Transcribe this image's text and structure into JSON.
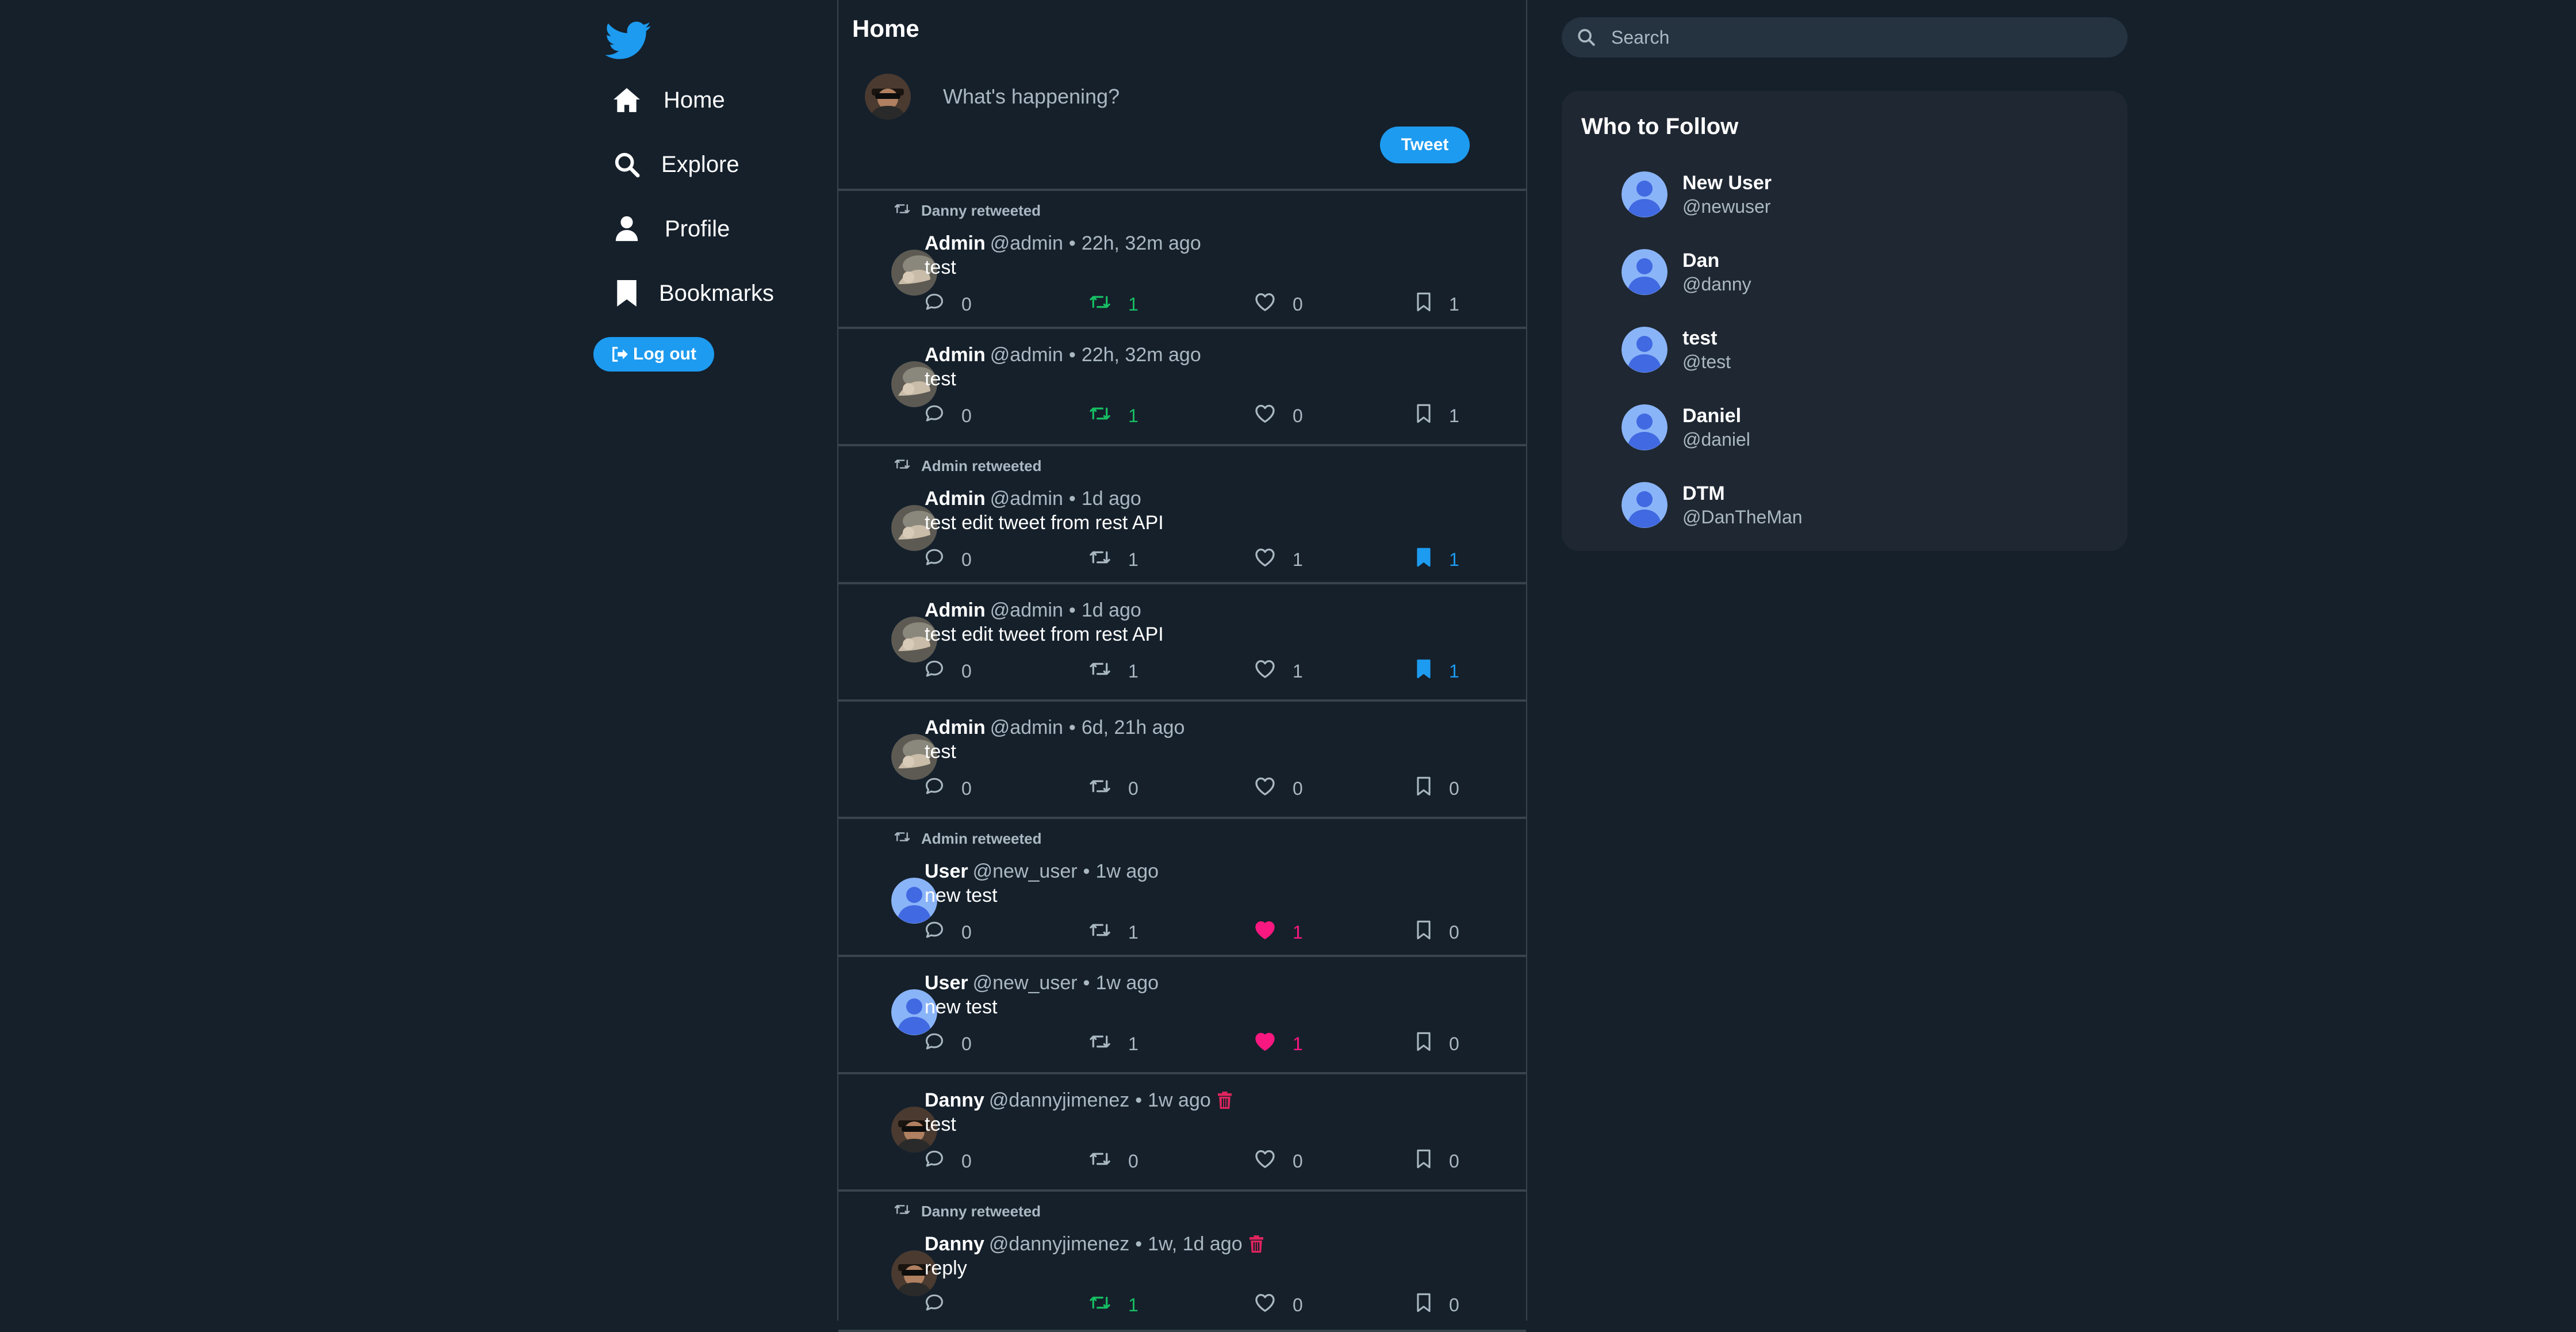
{
  "colors": {
    "background": "#15202b",
    "accent": "#1d9bf0",
    "retweet_active": "#17bf63",
    "like_active": "#f91880",
    "delete": "#e0245e",
    "muted": "#aab8c2",
    "border": "#38444d"
  },
  "nav": {
    "logo_icon": "twitter-bird-icon",
    "items": [
      {
        "label": "Home",
        "icon": "home-icon"
      },
      {
        "label": "Explore",
        "icon": "search-icon"
      },
      {
        "label": "Profile",
        "icon": "person-icon"
      },
      {
        "label": "Bookmarks",
        "icon": "bookmark-icon"
      }
    ],
    "logout_label": "Log out"
  },
  "feed": {
    "title": "Home",
    "composer": {
      "placeholder": "What's happening?",
      "button_label": "Tweet"
    },
    "tweets": [
      {
        "retweeted_by": "Danny retweeted",
        "name": "Admin",
        "handle": "@admin",
        "time": "22h, 32m ago",
        "text": "test",
        "replies": "0",
        "retweets": "1",
        "likes": "0",
        "bookmarks": "1",
        "retweeted": true,
        "liked": false,
        "bookmarked": false,
        "avatar": "photo-avatar"
      },
      {
        "retweeted_by": "",
        "name": "Admin",
        "handle": "@admin",
        "time": "22h, 32m ago",
        "text": "test",
        "replies": "0",
        "retweets": "1",
        "likes": "0",
        "bookmarks": "1",
        "retweeted": true,
        "liked": false,
        "bookmarked": false,
        "avatar": "photo-avatar"
      },
      {
        "retweeted_by": "Admin retweeted",
        "name": "Admin",
        "handle": "@admin",
        "time": "1d ago",
        "text": "test edit tweet from rest API",
        "replies": "0",
        "retweets": "1",
        "likes": "1",
        "bookmarks": "1",
        "retweeted": false,
        "liked": false,
        "bookmarked": true,
        "avatar": "photo-avatar"
      },
      {
        "retweeted_by": "",
        "name": "Admin",
        "handle": "@admin",
        "time": "1d ago",
        "text": "test edit tweet from rest API",
        "replies": "0",
        "retweets": "1",
        "likes": "1",
        "bookmarks": "1",
        "retweeted": false,
        "liked": false,
        "bookmarked": true,
        "avatar": "photo-avatar"
      },
      {
        "retweeted_by": "",
        "name": "Admin",
        "handle": "@admin",
        "time": "6d, 21h ago",
        "text": "test",
        "replies": "0",
        "retweets": "0",
        "likes": "0",
        "bookmarks": "0",
        "retweeted": false,
        "liked": false,
        "bookmarked": false,
        "avatar": "photo-avatar"
      },
      {
        "retweeted_by": "Admin retweeted",
        "name": "User",
        "handle": "@new_user",
        "time": "1w ago",
        "text": "new test",
        "replies": "0",
        "retweets": "1",
        "likes": "1",
        "bookmarks": "0",
        "retweeted": false,
        "liked": true,
        "bookmarked": false,
        "avatar": "default-avatar"
      },
      {
        "retweeted_by": "",
        "name": "User",
        "handle": "@new_user",
        "time": "1w ago",
        "text": "new test",
        "replies": "0",
        "retweets": "1",
        "likes": "1",
        "bookmarks": "0",
        "retweeted": false,
        "liked": true,
        "bookmarked": false,
        "avatar": "default-avatar"
      },
      {
        "retweeted_by": "",
        "name": "Danny",
        "handle": "@dannyjimenez",
        "time": "1w ago",
        "text": "test",
        "replies": "0",
        "retweets": "0",
        "likes": "0",
        "bookmarks": "0",
        "retweeted": false,
        "liked": false,
        "bookmarked": false,
        "deletable": true,
        "avatar": "photo-avatar-danny"
      },
      {
        "retweeted_by": "Danny retweeted",
        "name": "Danny",
        "handle": "@dannyjimenez",
        "time": "1w, 1d ago",
        "text": "reply",
        "replies": "",
        "retweets": "1",
        "likes": "0",
        "bookmarks": "0",
        "retweeted": true,
        "liked": false,
        "bookmarked": false,
        "deletable": true,
        "avatar": "photo-avatar-danny"
      }
    ]
  },
  "search": {
    "placeholder": "Search"
  },
  "who_to_follow": {
    "title": "Who to Follow",
    "users": [
      {
        "name": "New User",
        "handle": "@newuser"
      },
      {
        "name": "Dan",
        "handle": "@danny"
      },
      {
        "name": "test",
        "handle": "@test"
      },
      {
        "name": "Daniel",
        "handle": "@daniel"
      },
      {
        "name": "DTM",
        "handle": "@DanTheMan"
      }
    ]
  }
}
